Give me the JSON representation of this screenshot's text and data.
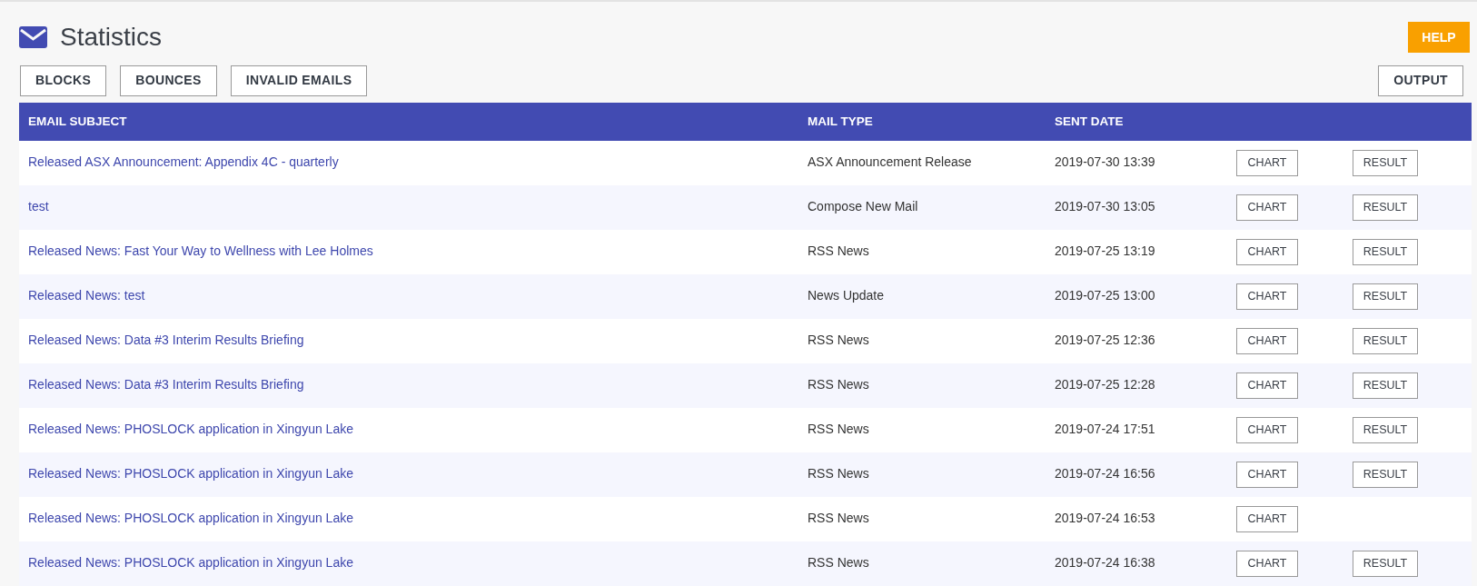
{
  "header": {
    "title": "Statistics",
    "help_button": "HELP"
  },
  "toolbar": {
    "buttons": [
      "BLOCKS",
      "BOUNCES",
      "INVALID EMAILS"
    ],
    "output_button": "OUTPUT"
  },
  "table": {
    "columns": [
      "EMAIL SUBJECT",
      "MAIL TYPE",
      "SENT DATE"
    ],
    "rows": [
      {
        "subject": "Released ASX Announcement: Appendix 4C - quarterly",
        "mail_type": "ASX Announcement Release",
        "sent_date": "2019-07-30 13:39",
        "chart": "CHART",
        "result": "RESULT"
      },
      {
        "subject": "test",
        "mail_type": "Compose New Mail",
        "sent_date": "2019-07-30 13:05",
        "chart": "CHART",
        "result": "RESULT"
      },
      {
        "subject": "Released News: Fast Your Way to Wellness with Lee Holmes",
        "mail_type": "RSS News",
        "sent_date": "2019-07-25 13:19",
        "chart": "CHART",
        "result": "RESULT"
      },
      {
        "subject": "Released News: test",
        "mail_type": "News Update",
        "sent_date": "2019-07-25 13:00",
        "chart": "CHART",
        "result": "RESULT"
      },
      {
        "subject": "Released News: Data #3 Interim Results Briefing",
        "mail_type": "RSS News",
        "sent_date": "2019-07-25 12:36",
        "chart": "CHART",
        "result": "RESULT"
      },
      {
        "subject": "Released News: Data #3 Interim Results Briefing",
        "mail_type": "RSS News",
        "sent_date": "2019-07-25 12:28",
        "chart": "CHART",
        "result": "RESULT"
      },
      {
        "subject": "Released News: PHOSLOCK application in Xingyun Lake",
        "mail_type": "RSS News",
        "sent_date": "2019-07-24 17:51",
        "chart": "CHART",
        "result": "RESULT"
      },
      {
        "subject": "Released News: PHOSLOCK application in Xingyun Lake",
        "mail_type": "RSS News",
        "sent_date": "2019-07-24 16:56",
        "chart": "CHART",
        "result": "RESULT"
      },
      {
        "subject": "Released News: PHOSLOCK application in Xingyun Lake",
        "mail_type": "RSS News",
        "sent_date": "2019-07-24 16:53",
        "chart": "CHART"
      },
      {
        "subject": "Released News: PHOSLOCK application in Xingyun Lake",
        "mail_type": "RSS News",
        "sent_date": "2019-07-24 16:38",
        "chart": "CHART",
        "result": "RESULT"
      }
    ]
  }
}
